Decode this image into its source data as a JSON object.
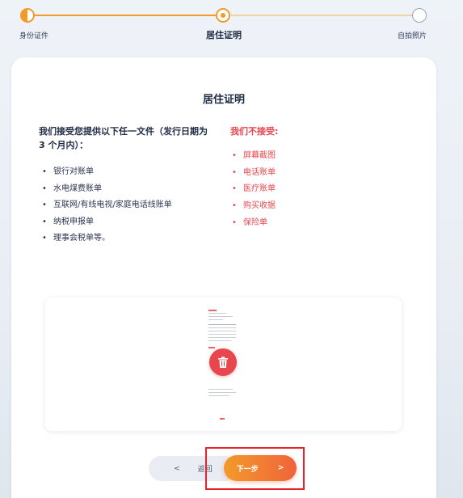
{
  "stepper": {
    "steps": [
      {
        "label": "身份证件",
        "state": "done"
      },
      {
        "label": "居住证明",
        "state": "active"
      },
      {
        "label": "自拍照片",
        "state": "pending"
      }
    ],
    "accent": "#f39a2b"
  },
  "card": {
    "title": "居住证明",
    "accept": {
      "heading": "我们接受您提供以下任一文件（发行日期为 3 个月内）：",
      "items": [
        "银行对账单",
        "水电煤费账单",
        "互联网/有线电视/家庭电话线账单",
        "纳税申报单",
        "理事会税单等。"
      ]
    },
    "reject": {
      "heading": "我们不接受:",
      "items": [
        "屏幕截图",
        "电话账单",
        "医疗账单",
        "购买收据",
        "保险单"
      ],
      "color": "#e8474e"
    },
    "preview": {
      "delete_icon": "trash-icon"
    }
  },
  "actions": {
    "back_label": "返回",
    "back_arrow": "<",
    "next_label": "下一步",
    "next_arrow": ">"
  }
}
